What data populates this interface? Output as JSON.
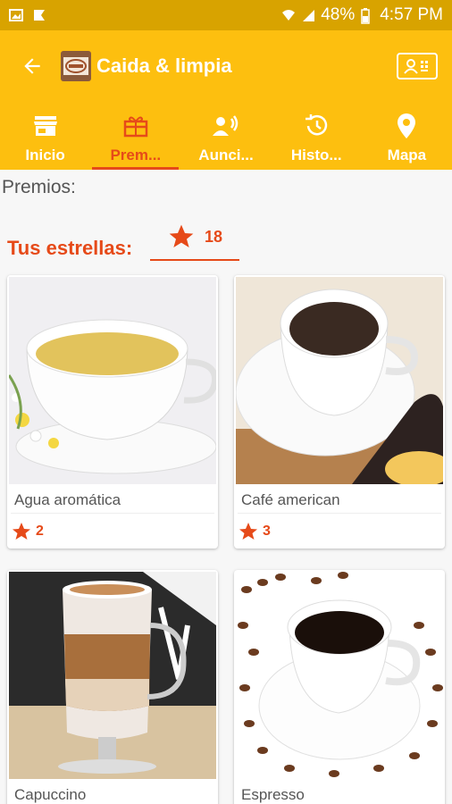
{
  "status": {
    "battery": "48%",
    "time": "4:57 PM"
  },
  "appbar": {
    "title": "Caida & limpia"
  },
  "tabs": [
    {
      "label": "Inicio",
      "icon": "store-icon"
    },
    {
      "label": "Prem...",
      "icon": "gift-icon",
      "active": true
    },
    {
      "label": "Aunci...",
      "icon": "announcement-icon"
    },
    {
      "label": "Histo...",
      "icon": "history-icon"
    },
    {
      "label": "Mapa",
      "icon": "map-pin-icon"
    }
  ],
  "content": {
    "section_title": "Premios:",
    "stars_label": "Tus estrellas:",
    "stars_count": "18"
  },
  "rewards": [
    {
      "name": "Agua aromática",
      "stars": "2"
    },
    {
      "name": "Café american",
      "stars": "3"
    },
    {
      "name": "Capuccino",
      "stars": ""
    },
    {
      "name": "Espresso",
      "stars": ""
    }
  ],
  "colors": {
    "primary": "#fdbf0f",
    "status_bar": "#d8a300",
    "accent": "#e64a19"
  }
}
